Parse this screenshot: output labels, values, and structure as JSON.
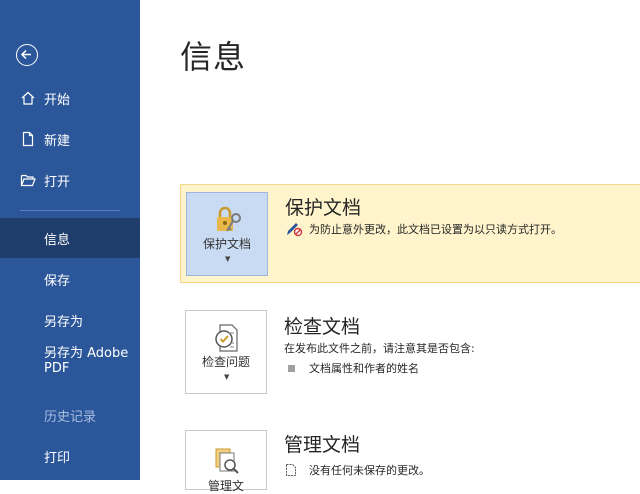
{
  "sidebar": {
    "items": [
      {
        "label": "开始",
        "icon": "home-icon"
      },
      {
        "label": "新建",
        "icon": "new-document-icon"
      },
      {
        "label": "打开",
        "icon": "open-folder-icon"
      },
      {
        "label": "信息",
        "active": true
      },
      {
        "label": "保存"
      },
      {
        "label": "另存为"
      },
      {
        "label": "另存为 Adobe PDF"
      },
      {
        "label": "历史记录",
        "disabled": true
      },
      {
        "label": "打印"
      }
    ]
  },
  "page": {
    "title": "信息"
  },
  "protect": {
    "tile_label": "保护文档",
    "title": "保护文档",
    "desc": "为防止意外更改，此文档已设置为以只读方式打开。"
  },
  "inspect": {
    "tile_label": "检查问题",
    "title": "检查文档",
    "desc": "在发布此文件之前，请注意其是否包含:",
    "bullets": [
      "文档属性和作者的姓名"
    ]
  },
  "manage": {
    "tile_label": "管理文",
    "title": "管理文档",
    "desc": "没有任何未保存的更改。"
  },
  "colors": {
    "sidebar": "#2b579a",
    "active": "#1e3d6b",
    "protect_bg": "#fff4cc"
  }
}
